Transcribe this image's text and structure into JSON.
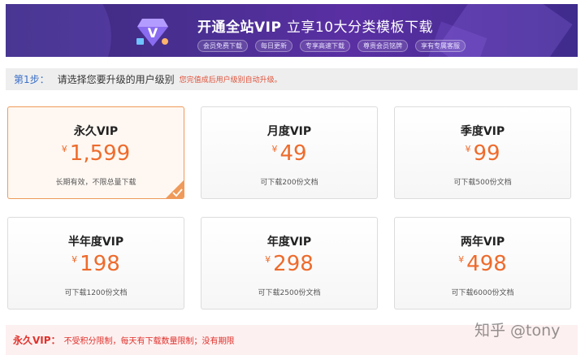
{
  "banner": {
    "title_bold": "开通全站VIP",
    "title_plain": "立享10大分类模板下载",
    "tags": [
      "会员免费下载",
      "每日更新",
      "专享高速下载",
      "尊贵会员铭牌",
      "享有专属客服"
    ]
  },
  "step": {
    "label": "第1步：",
    "text": "请选择您要升级的用户级别",
    "note": "您完值成后用户级别自动升级。"
  },
  "plans": [
    {
      "name": "永久VIP",
      "currency": "¥",
      "price": "1,599",
      "desc": "长期有效，不限总量下载",
      "selected": true
    },
    {
      "name": "月度VIP",
      "currency": "¥",
      "price": "49",
      "desc": "可下载200份文档",
      "selected": false
    },
    {
      "name": "季度VIP",
      "currency": "¥",
      "price": "99",
      "desc": "可下载500份文档",
      "selected": false
    },
    {
      "name": "半年度VIP",
      "currency": "¥",
      "price": "198",
      "desc": "可下载1200份文档",
      "selected": false
    },
    {
      "name": "年度VIP",
      "currency": "¥",
      "price": "298",
      "desc": "可下载2500份文档",
      "selected": false
    },
    {
      "name": "两年VIP",
      "currency": "¥",
      "price": "498",
      "desc": "可下载6000份文档",
      "selected": false
    }
  ],
  "footer": {
    "label": "永久VIP：",
    "text": "不受积分限制，每天有下载数量限制；没有期限"
  },
  "watermark": "知乎 @tony",
  "colors": {
    "accent": "#ee6b2c",
    "selected_border": "#ef9a5a",
    "step_label": "#3a6fc7",
    "warning": "#e0312b"
  }
}
